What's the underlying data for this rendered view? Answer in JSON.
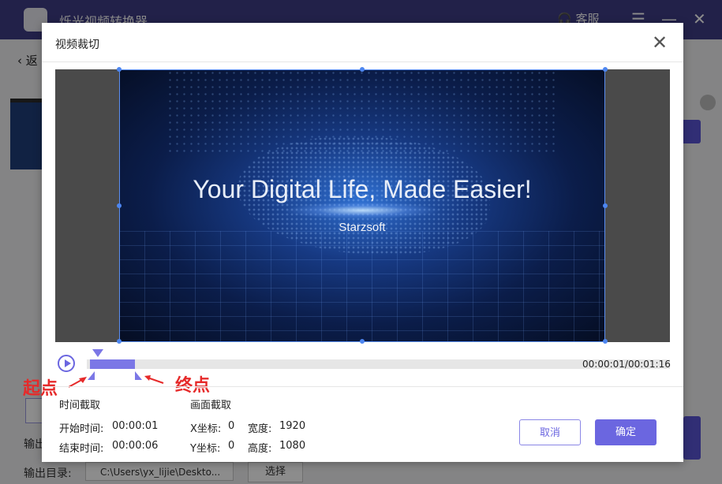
{
  "app": {
    "title": "烁光视频转换器",
    "customer_service": "客服",
    "back_label": "返",
    "output_format_label": "输出",
    "output_dir_label": "输出目录:",
    "output_path": "C:\\Users\\yx_lijie\\Deskto...",
    "choose_label": "选择"
  },
  "dialog": {
    "title": "视频裁切",
    "close_icon": "close-icon"
  },
  "video": {
    "headline": "Your Digital Life, Made Easier!",
    "brand": "Starzsoft"
  },
  "timeline": {
    "timecode": "00:00:01/00:01:16",
    "start_annotation": "起点",
    "end_annotation": "终点"
  },
  "time_crop": {
    "heading": "时间截取",
    "start_label": "开始时间:",
    "start_value": "00:00:01",
    "end_label": "结束时间:",
    "end_value": "00:00:06"
  },
  "frame_crop": {
    "heading": "画面截取",
    "x_label": "X坐标:",
    "x_value": "0",
    "y_label": "Y坐标:",
    "y_value": "0",
    "width_label": "宽度:",
    "width_value": "1920",
    "height_label": "高度:",
    "height_value": "1080"
  },
  "buttons": {
    "cancel": "取消",
    "ok": "确定"
  },
  "colors": {
    "accent": "#6b66e0",
    "titlebar": "#3f3c86",
    "annotation": "#e62a2a"
  }
}
